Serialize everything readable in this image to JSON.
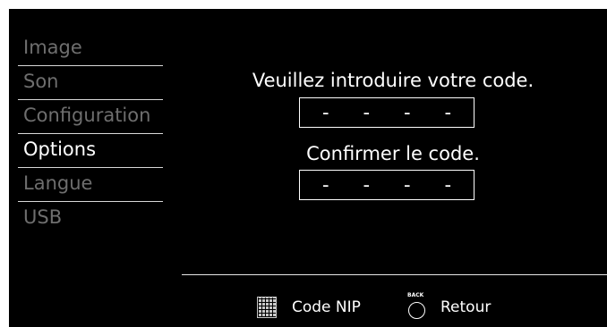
{
  "menu": {
    "items": [
      {
        "label": "Image"
      },
      {
        "label": "Son"
      },
      {
        "label": "Configuration"
      },
      {
        "label": "Options",
        "active": true
      },
      {
        "label": "Langue"
      },
      {
        "label": "USB"
      }
    ]
  },
  "main": {
    "enter_prompt": "Veuillez introduire votre code.",
    "confirm_prompt": "Confirmer le code.",
    "code_placeholder": [
      "-",
      "-",
      "-",
      "-"
    ],
    "confirm_placeholder": [
      "-",
      "-",
      "-",
      "-"
    ]
  },
  "footer": {
    "pin_label": "Code NIP",
    "back_icon_text": "BACK",
    "back_label": "Retour"
  },
  "colors": {
    "background": "#000000",
    "text": "#ffffff",
    "inactive_text": "#6e6e6e"
  }
}
